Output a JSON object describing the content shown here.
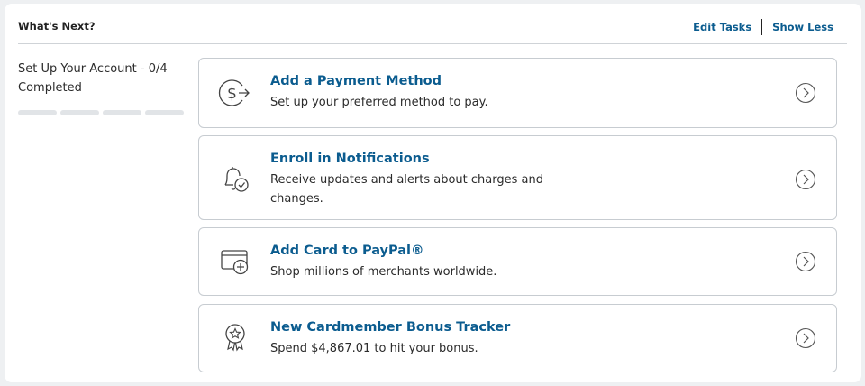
{
  "header": {
    "title": "What's Next?",
    "edit_tasks": "Edit Tasks",
    "show_less": "Show Less"
  },
  "progress": {
    "text": "Set Up Your Account - 0/4 Completed",
    "completed": 0,
    "total": 4
  },
  "tasks": [
    {
      "title": "Add a Payment Method",
      "description": "Set up your preferred method to pay.",
      "icon": "payment-icon"
    },
    {
      "title": "Enroll in Notifications",
      "description": "Receive updates and alerts about charges and changes.",
      "icon": "notification-bell-icon"
    },
    {
      "title": "Add Card to PayPal®",
      "description": "Shop millions of merchants worldwide.",
      "icon": "add-card-icon"
    },
    {
      "title": "New Cardmember Bonus Tracker",
      "description": "Spend $4,867.01 to hit your bonus.",
      "icon": "award-ribbon-icon"
    }
  ],
  "colors": {
    "link": "#0b5c8f",
    "border": "#c7ccd1",
    "background": "#eef0f2"
  }
}
